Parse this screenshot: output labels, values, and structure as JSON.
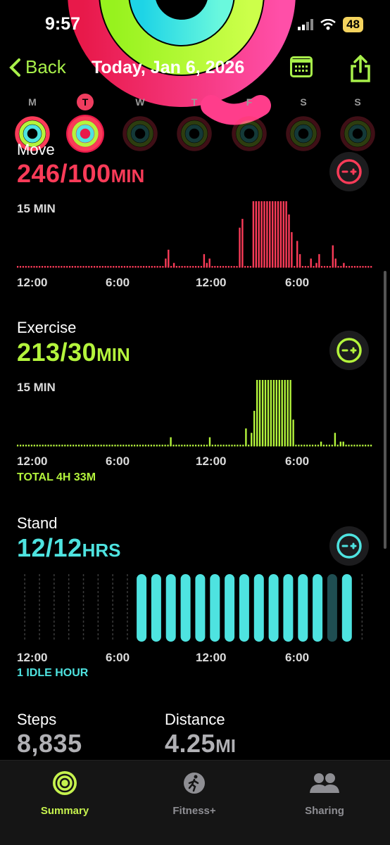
{
  "status": {
    "time": "9:57",
    "battery": "48"
  },
  "nav": {
    "back_label": "Back",
    "title": "Today, Jan 6, 2026"
  },
  "week": {
    "days": [
      "M",
      "T",
      "W",
      "T",
      "F",
      "S",
      "S"
    ],
    "selected_index": 1
  },
  "colors": {
    "move": "#fa3b58",
    "exercise": "#b4f43c",
    "stand": "#4ee3e0",
    "accent": "#a8f04a"
  },
  "move": {
    "label": "Move",
    "value": "246/100",
    "unit": "MIN",
    "scale_label": "15 MIN",
    "ticks": [
      "12:00",
      "6:00",
      "12:00",
      "6:00"
    ]
  },
  "exercise": {
    "label": "Exercise",
    "value": "213/30",
    "unit": "MIN",
    "scale_label": "15 MIN",
    "ticks": [
      "12:00",
      "6:00",
      "12:00",
      "6:00"
    ],
    "total": "TOTAL 4H 33M"
  },
  "stand": {
    "label": "Stand",
    "value": "12/12",
    "unit": "HRS",
    "ticks": [
      "12:00",
      "6:00",
      "12:00",
      "6:00"
    ],
    "idle": "1 IDLE HOUR"
  },
  "steps": {
    "label": "Steps",
    "value": "8,835"
  },
  "distance": {
    "label": "Distance",
    "value": "4.25",
    "unit": "MI"
  },
  "tabs": [
    {
      "label": "Summary",
      "icon": "activity-rings-icon"
    },
    {
      "label": "Fitness+",
      "icon": "runner-icon"
    },
    {
      "label": "Sharing",
      "icon": "people-icon"
    }
  ],
  "chart_data": [
    {
      "type": "bar",
      "title": "Move",
      "ylabel": "15 MIN",
      "x_ticks": [
        "12:00",
        "6:00",
        "12:00",
        "6:00"
      ],
      "values": [
        0,
        0,
        0,
        0,
        0,
        0,
        0,
        0,
        0,
        0,
        0,
        0,
        0,
        0,
        0,
        0,
        0,
        0,
        0,
        0,
        0,
        0,
        0,
        0,
        0,
        0,
        0,
        0,
        0,
        0,
        0,
        0,
        0,
        0,
        0,
        0,
        0,
        0,
        0,
        0,
        0,
        0,
        0,
        0,
        0,
        0,
        0,
        0,
        0,
        0,
        0,
        0,
        0,
        0,
        2,
        4,
        0,
        1,
        0,
        0,
        0,
        0,
        0,
        0,
        0,
        0,
        0,
        0,
        3,
        1,
        2,
        0,
        0,
        0,
        0,
        0,
        0,
        0,
        0,
        0,
        0,
        9,
        11,
        0,
        0,
        0,
        15,
        15,
        15,
        15,
        15,
        15,
        15,
        15,
        15,
        15,
        15,
        15,
        15,
        12,
        8,
        0,
        6,
        3,
        0,
        0,
        0,
        2,
        0,
        1,
        3,
        0,
        0,
        0,
        0,
        5,
        2,
        0,
        0,
        1,
        0,
        0,
        0,
        0,
        0,
        0,
        0,
        0,
        0,
        0
      ],
      "ylim": [
        0,
        15
      ]
    },
    {
      "type": "bar",
      "title": "Exercise",
      "ylabel": "15 MIN",
      "x_ticks": [
        "12:00",
        "6:00",
        "12:00",
        "6:00"
      ],
      "values": [
        0,
        0,
        0,
        0,
        0,
        0,
        0,
        0,
        0,
        0,
        0,
        0,
        0,
        0,
        0,
        0,
        0,
        0,
        0,
        0,
        0,
        0,
        0,
        0,
        0,
        0,
        0,
        0,
        0,
        0,
        0,
        0,
        0,
        0,
        0,
        0,
        0,
        0,
        0,
        0,
        0,
        0,
        0,
        0,
        0,
        0,
        0,
        0,
        0,
        0,
        0,
        0,
        0,
        0,
        0,
        2,
        0,
        0,
        0,
        0,
        0,
        0,
        0,
        0,
        0,
        0,
        0,
        0,
        0,
        2,
        0,
        0,
        0,
        0,
        0,
        0,
        0,
        0,
        0,
        0,
        0,
        0,
        4,
        0,
        3,
        8,
        15,
        15,
        15,
        15,
        15,
        15,
        15,
        15,
        15,
        15,
        15,
        15,
        15,
        6,
        0,
        0,
        0,
        0,
        0,
        0,
        0,
        0,
        0,
        1,
        0,
        0,
        0,
        0,
        3,
        0,
        1,
        1,
        0,
        0,
        0,
        0,
        0,
        0,
        0,
        0,
        0,
        0
      ],
      "ylim": [
        0,
        15
      ]
    },
    {
      "type": "bar",
      "title": "Stand",
      "x_ticks": [
        "12:00",
        "6:00",
        "12:00",
        "6:00"
      ],
      "hours_stood": [
        0,
        0,
        0,
        0,
        0,
        0,
        0,
        0,
        1,
        1,
        1,
        1,
        1,
        1,
        1,
        1,
        1,
        1,
        1,
        1,
        1,
        0,
        1,
        0
      ],
      "idle": "1 IDLE HOUR"
    }
  ]
}
